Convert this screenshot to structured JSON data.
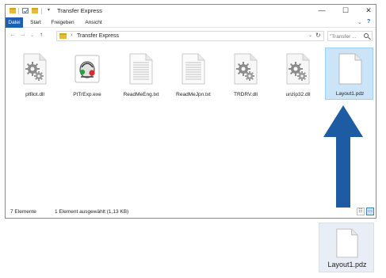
{
  "window": {
    "title": "Transfer Express",
    "title_arrow": "▾",
    "controls": {
      "minimize": "—",
      "maximize": "☐",
      "close": "✕"
    }
  },
  "ribbon": {
    "tabs": [
      "Datei",
      "Start",
      "Freigeben",
      "Ansicht"
    ],
    "collapse": "⌄",
    "help": "?"
  },
  "address": {
    "back": "←",
    "forward": "→",
    "recent": "⌄",
    "up": "↑",
    "separator": "›",
    "path": "Transfer Express",
    "dropdown": "⌄",
    "refresh": "↻",
    "search_placeholder": "\"Transfer ..."
  },
  "files": [
    {
      "name": "ptfilot.dll",
      "icon": "dll-gear-icon"
    },
    {
      "name": "PtTrExp.exe",
      "icon": "exe-app-icon"
    },
    {
      "name": "ReadMeEng.txt",
      "icon": "text-document-icon"
    },
    {
      "name": "ReadMeJpn.txt",
      "icon": "text-document-icon"
    },
    {
      "name": "TRDRV.dll",
      "icon": "dll-gear-icon"
    },
    {
      "name": "unzip32.dll",
      "icon": "dll-gear-icon"
    },
    {
      "name": "Layout1.pdz",
      "icon": "blank-document-icon",
      "selected": true
    }
  ],
  "status": {
    "count": "7 Elemente",
    "selection": "1 Element ausgewählt (1,13 KB)",
    "view_details": "☷",
    "view_icons": "▭"
  },
  "floating_file": {
    "name": "Layout1.pdz",
    "icon": "blank-document-icon"
  },
  "colors": {
    "accent": "#1a5fb4",
    "selection_bg": "#cce4f7",
    "arrow": "#1d5ba3",
    "folder": "#e8b938"
  }
}
